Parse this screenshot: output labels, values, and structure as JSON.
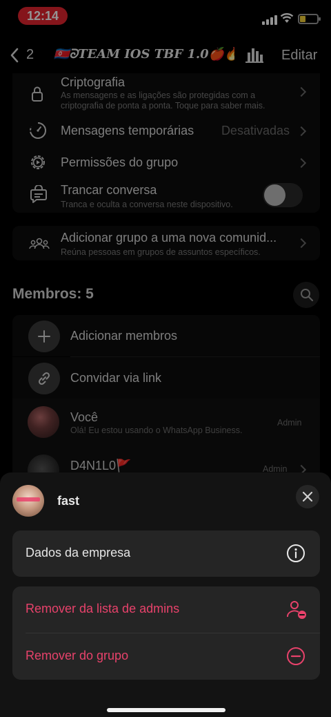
{
  "status_bar": {
    "time": "12:14"
  },
  "nav": {
    "back_count": "2",
    "group_title": "🇰🇵ᘐ𝑻𝑬𝑨𝑴 𝑰𝑶𝑺 𝑻𝑩𝑭 1.0🍎🔥",
    "edit_label": "Editar"
  },
  "settings": {
    "encryption": {
      "title": "Criptografia",
      "subtitle": "As mensagens e as ligações são protegidas com a criptografia de ponta a ponta. Toque para saber mais."
    },
    "disappearing": {
      "title": "Mensagens temporárias",
      "value": "Desativadas"
    },
    "permissions": {
      "title": "Permissões do grupo"
    },
    "lock_chat": {
      "title": "Trancar conversa",
      "subtitle": "Tranca e oculta a conversa neste dispositivo.",
      "enabled": false
    }
  },
  "community": {
    "title": "Adicionar grupo a uma nova comunid...",
    "subtitle": "Reúna pessoas em grupos de assuntos específicos."
  },
  "members": {
    "header": "Membros: 5",
    "add_label": "Adicionar membros",
    "invite_label": "Convidar via link",
    "list": [
      {
        "name": "Você",
        "status": "Olá! Eu estou usando o WhatsApp Business.",
        "badge": "Admin"
      },
      {
        "name": "D4N1L0🚩",
        "badge": "Admin"
      }
    ]
  },
  "sheet": {
    "contact_name": "fast",
    "business_info": "Dados da empresa",
    "remove_admin": "Remover da lista de admins",
    "remove_group": "Remover do grupo",
    "danger_color": "#e8426b"
  }
}
